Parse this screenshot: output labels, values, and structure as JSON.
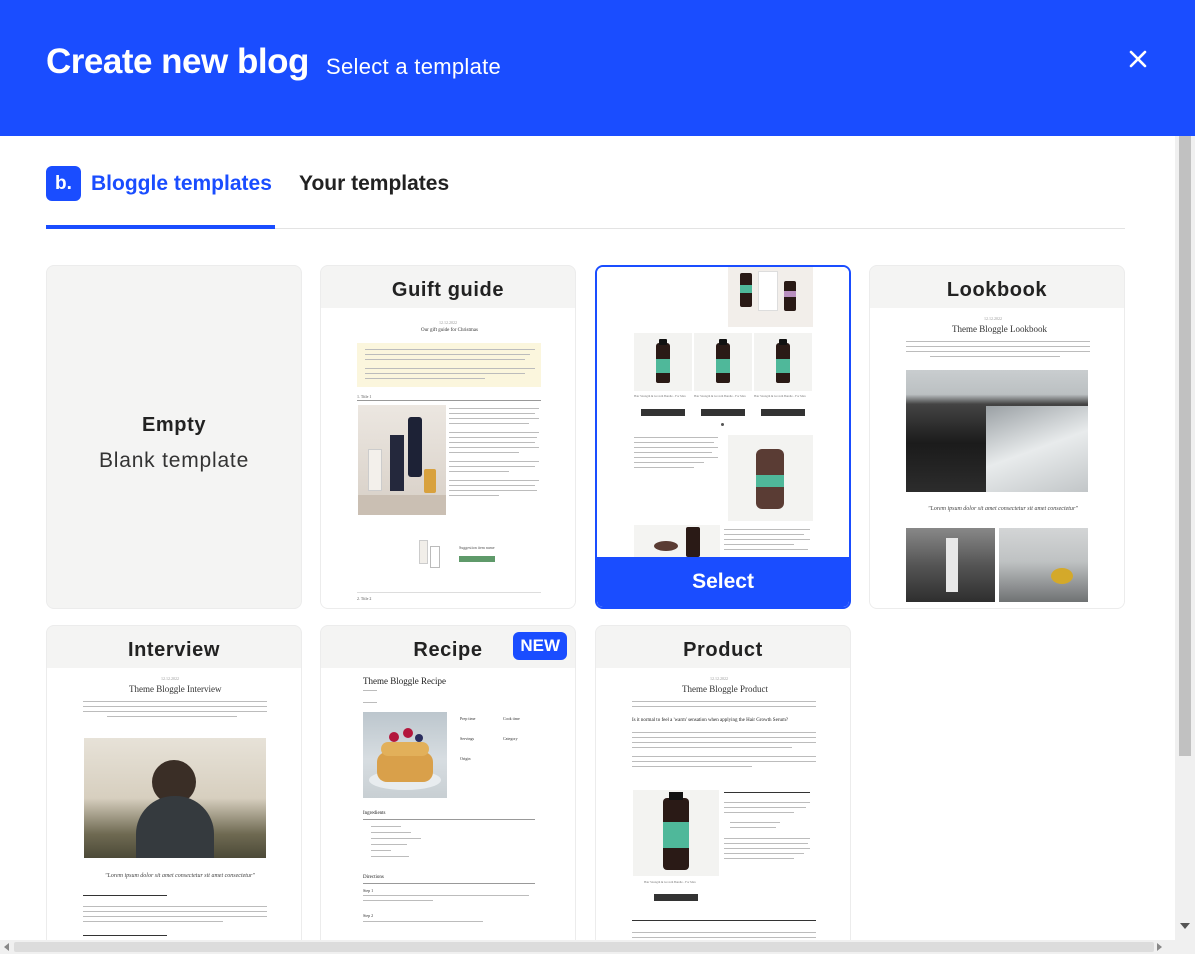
{
  "header": {
    "title": "Create new blog",
    "subtitle": "Select a template",
    "close_icon": "close-icon"
  },
  "tabs": [
    {
      "label": "Bloggle templates",
      "logo": "b.",
      "active": true
    },
    {
      "label": "Your templates",
      "active": false
    }
  ],
  "cards": {
    "empty": {
      "title": "Empty",
      "subtitle": "Blank template"
    },
    "gift": {
      "title": "Guift guide",
      "date": "12.12.2022",
      "heading": "Our gift guide for Christmas",
      "section1": "1. Title 1",
      "section2": "2. Title 2",
      "suggest": "Suggestion item name"
    },
    "selected": {
      "select_label": "Select",
      "product_name": "Hair Strength & Growth Bundle - For Man"
    },
    "lookbook": {
      "title": "Lookbook",
      "date": "12.12.2022",
      "heading": "Theme Bloggle Lookbook",
      "quote": "\"Lorem ipsum dolor sit amet consectetur sit amet consectetur\""
    },
    "interview": {
      "title": "Interview",
      "date": "12.12.2022",
      "heading": "Theme Bloggle Interview",
      "quote": "\"Lorem ipsum dolor sit amet consectetur sit amet consectetur\""
    },
    "recipe": {
      "title": "Recipe",
      "badge": "NEW",
      "heading": "Theme Bloggle Recipe",
      "ingredients_label": "Ingredients",
      "directions_label": "Directions",
      "step1": "Step 1",
      "step2": "Step 2",
      "info": [
        "Prep time",
        "Cook time",
        "Servings",
        "Category",
        "Origin"
      ]
    },
    "product": {
      "title": "Product",
      "date": "12.12.2022",
      "heading": "Theme Bloggle Product",
      "question": "Is it normal to feel a 'warm' sensation when applying the Hair Growth Serum?"
    }
  },
  "colors": {
    "accent": "#1a4dff",
    "card_bg": "#f4f4f3"
  }
}
